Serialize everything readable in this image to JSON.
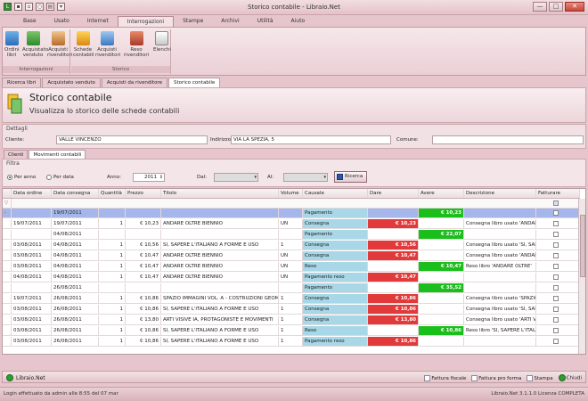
{
  "window": {
    "title": "Storico contabile - Libraio.Net",
    "buttons": {
      "minimize": "—",
      "maximize": "□",
      "close": "✕"
    }
  },
  "ribbon_tabs": [
    "Base",
    "Usato",
    "Internet",
    "Interrogazioni",
    "Stampe",
    "Archivi",
    "Utilità",
    "Aiuto"
  ],
  "ribbon": {
    "groups": [
      {
        "title": "Interrogazioni",
        "buttons": [
          "Ordini libri",
          "Acquistato venduto",
          "Acquisti rivenditori"
        ]
      },
      {
        "title": "Storico",
        "buttons": [
          "Schede contabili",
          "Acquisti rivenditori",
          "Reso rivenditori",
          "Elenchi"
        ]
      }
    ]
  },
  "doc_tabs": [
    "Ricerca libri",
    "Acquistato venduto",
    "Acquisti da rivenditore",
    "Storico contabile"
  ],
  "header": {
    "title": "Storico contabile",
    "subtitle": "Visualizza lo storico delle schede contabili"
  },
  "dettagli": {
    "section": "Dettagli",
    "cliente_label": "Cliente:",
    "cliente_value": "VALLE VINCENZO",
    "indirizzo_label": "Indirizzo:",
    "indirizzo_value": "VIA LA SPEZIA, 5",
    "comune_label": "Comune:",
    "comune_value": ""
  },
  "sub_tabs": [
    "Clienti",
    "Movimenti contabili"
  ],
  "filtra": {
    "section": "Filtra",
    "per_anno": "Per anno",
    "per_data": "Per data",
    "anno_label": "Anno:",
    "anno_value": "2011",
    "dal_label": "Dal:",
    "al_label": "Al:",
    "ricerca_label": "Ricerca"
  },
  "table": {
    "headers": [
      "Data ordine",
      "Data consegna",
      "Quantità",
      "Prezzo",
      "Titolo",
      "Volume",
      "Causale",
      "Dare",
      "Avere",
      "Descrizione",
      "Fatturare"
    ],
    "rows": [
      {
        "ordine": "",
        "consegna": "19/07/2011",
        "qty": "",
        "prezzo": "",
        "titolo": "",
        "volume": "",
        "causale": "Pagamento",
        "dare": "",
        "avere": "€ 10,23",
        "descr": ""
      },
      {
        "ordine": "19/07/2011",
        "consegna": "19/07/2011",
        "qty": "1",
        "prezzo": "€ 10,23",
        "titolo": "ANDARE OLTRE BIENNIO",
        "volume": "UN",
        "causale": "Consegna",
        "dare": "€ 10,23",
        "avere": "",
        "descr": "Consegna libro usato 'ANDARE ..."
      },
      {
        "ordine": "",
        "consegna": "04/08/2011",
        "qty": "",
        "prezzo": "",
        "titolo": "",
        "volume": "",
        "causale": "Pagamento",
        "dare": "",
        "avere": "€ 22,07",
        "descr": ""
      },
      {
        "ordine": "03/08/2011",
        "consegna": "04/08/2011",
        "qty": "1",
        "prezzo": "€ 10,56",
        "titolo": "SI, SAPERE L'ITALIANO A FORME E USO",
        "volume": "1",
        "causale": "Consegna",
        "dare": "€ 10,56",
        "avere": "",
        "descr": "Consegna libro usato 'SI, SAPE..."
      },
      {
        "ordine": "03/08/2011",
        "consegna": "04/08/2011",
        "qty": "1",
        "prezzo": "€ 10,47",
        "titolo": "ANDARE OLTRE BIENNIO",
        "volume": "UN",
        "causale": "Consegna",
        "dare": "€ 10,47",
        "avere": "",
        "descr": "Consegna libro usato 'ANDARE ..."
      },
      {
        "ordine": "03/08/2011",
        "consegna": "04/08/2011",
        "qty": "1",
        "prezzo": "€ 10,47",
        "titolo": "ANDARE OLTRE BIENNIO",
        "volume": "UN",
        "causale": "Reso",
        "dare": "",
        "avere": "€ 10,47",
        "descr": "Reso libro 'ANDARE OLTRE'"
      },
      {
        "ordine": "04/08/2011",
        "consegna": "04/08/2011",
        "qty": "1",
        "prezzo": "€ 10,47",
        "titolo": "ANDARE OLTRE BIENNIO",
        "volume": "UN",
        "causale": "Pagamento reso",
        "dare": "€ 10,47",
        "avere": "",
        "descr": ""
      },
      {
        "ordine": "",
        "consegna": "26/08/2011",
        "qty": "",
        "prezzo": "",
        "titolo": "",
        "volume": "",
        "causale": "Pagamento",
        "dare": "",
        "avere": "€ 35,52",
        "descr": ""
      },
      {
        "ordine": "19/07/2011",
        "consegna": "26/08/2011",
        "qty": "1",
        "prezzo": "€ 10,86",
        "titolo": "SPAZIO IMMAGINI VOL. A - COSTRUZIONI GEOMET...",
        "volume": "1",
        "causale": "Consegna",
        "dare": "€ 10,86",
        "avere": "",
        "descr": "Consegna libro usato 'SPAZIO I..."
      },
      {
        "ordine": "03/08/2011",
        "consegna": "26/08/2011",
        "qty": "1",
        "prezzo": "€ 10,86",
        "titolo": "SI, SAPERE L'ITALIANO A FORME E USO",
        "volume": "1",
        "causale": "Consegna",
        "dare": "€ 10,86",
        "avere": "",
        "descr": "Consegna libro usato 'SI, SAPE..."
      },
      {
        "ordine": "03/08/2011",
        "consegna": "26/08/2011",
        "qty": "1",
        "prezzo": "€ 13,80",
        "titolo": "ARTI VISIVE IA, PROTAGONISTE E MOVIMENTI",
        "volume": "1",
        "causale": "Consegna",
        "dare": "€ 13,80",
        "avere": "",
        "descr": "Consegna libro usato 'ARTI VIS..."
      },
      {
        "ordine": "03/08/2011",
        "consegna": "26/08/2011",
        "qty": "1",
        "prezzo": "€ 10,86",
        "titolo": "SI, SAPERE L'ITALIANO A FORME E USO",
        "volume": "1",
        "causale": "Reso",
        "dare": "",
        "avere": "€ 10,86",
        "descr": "Reso libro 'SI, SAPERE L'ITALIA..."
      },
      {
        "ordine": "03/08/2011",
        "consegna": "26/08/2011",
        "qty": "1",
        "prezzo": "€ 10,86",
        "titolo": "SI, SAPERE L'ITALIANO A FORME E USO",
        "volume": "1",
        "causale": "Pagamento reso",
        "dare": "€ 10,86",
        "avere": "",
        "descr": ""
      }
    ]
  },
  "bottom": {
    "app_name": "Libraio.Net",
    "actions": [
      "Fattura fiscale",
      "Fattura pro forma",
      "Stampa",
      "Chiudi"
    ]
  },
  "status": {
    "left": "Login effettuato da admin alle 8:55 del 07 mar",
    "right": "Libraio.Net 3.1.1.0 Licenza COMPLETA"
  },
  "colors": {
    "dare": "#e23a3a",
    "avere": "#1bbf1b",
    "causale": "#a8d7e7",
    "selected": "#a5b7ea"
  }
}
